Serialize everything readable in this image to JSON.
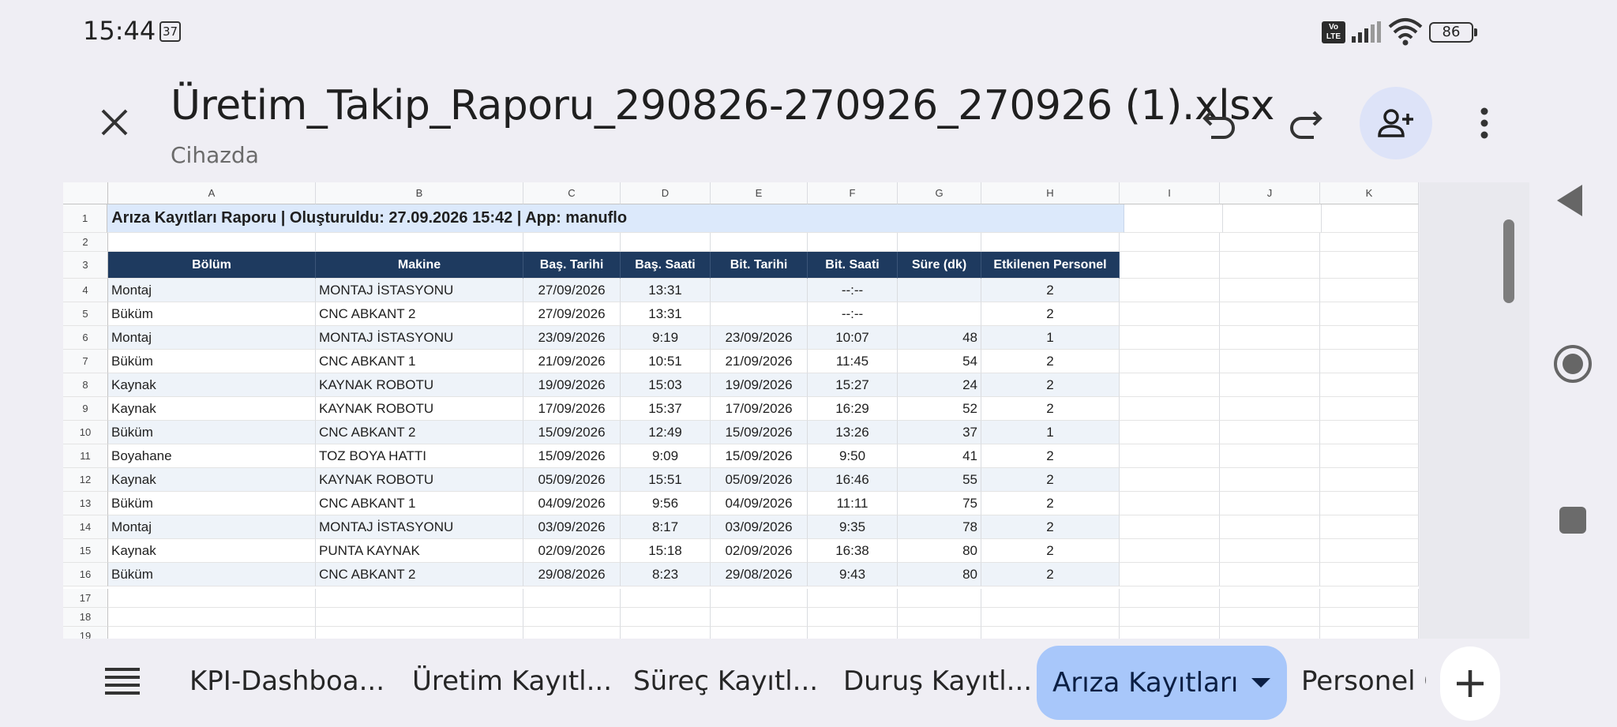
{
  "status": {
    "time": "15:44",
    "notification_count": "37",
    "network_badge": "Vo\nLTE",
    "battery": "86"
  },
  "appbar": {
    "title": "Üretim_Takip_Raporu_290826-270926_270926 (1).xlsx",
    "subtitle": "Cihazda"
  },
  "sheet": {
    "columns": [
      "A",
      "B",
      "C",
      "D",
      "E",
      "F",
      "G",
      "H",
      "I",
      "J",
      "K"
    ],
    "title_row": "Arıza Kayıtları Raporu  |  Oluşturuldu: 27.09.2026 15:42  |  App: manuflo",
    "headers": [
      "Bölüm",
      "Makine",
      "Baş. Tarihi",
      "Baş. Saati",
      "Bit. Tarihi",
      "Bit. Saati",
      "Süre (dk)",
      "Etkilenen Personel"
    ],
    "rows": [
      [
        "Montaj",
        "MONTAJ İSTASYONU",
        "27/09/2026",
        "13:31",
        "",
        "--:--",
        "",
        "2"
      ],
      [
        "Büküm",
        "CNC ABKANT 2",
        "27/09/2026",
        "13:31",
        "",
        "--:--",
        "",
        "2"
      ],
      [
        "Montaj",
        "MONTAJ İSTASYONU",
        "23/09/2026",
        "9:19",
        "23/09/2026",
        "10:07",
        "48",
        "1"
      ],
      [
        "Büküm",
        "CNC ABKANT 1",
        "21/09/2026",
        "10:51",
        "21/09/2026",
        "11:45",
        "54",
        "2"
      ],
      [
        "Kaynak",
        "KAYNAK ROBOTU",
        "19/09/2026",
        "15:03",
        "19/09/2026",
        "15:27",
        "24",
        "2"
      ],
      [
        "Kaynak",
        "KAYNAK ROBOTU",
        "17/09/2026",
        "15:37",
        "17/09/2026",
        "16:29",
        "52",
        "2"
      ],
      [
        "Büküm",
        "CNC ABKANT 2",
        "15/09/2026",
        "12:49",
        "15/09/2026",
        "13:26",
        "37",
        "1"
      ],
      [
        "Boyahane",
        "TOZ BOYA HATTI",
        "15/09/2026",
        "9:09",
        "15/09/2026",
        "9:50",
        "41",
        "2"
      ],
      [
        "Kaynak",
        "KAYNAK ROBOTU",
        "05/09/2026",
        "15:51",
        "05/09/2026",
        "16:46",
        "55",
        "2"
      ],
      [
        "Büküm",
        "CNC ABKANT 1",
        "04/09/2026",
        "9:56",
        "04/09/2026",
        "11:11",
        "75",
        "2"
      ],
      [
        "Montaj",
        "MONTAJ İSTASYONU",
        "03/09/2026",
        "8:17",
        "03/09/2026",
        "9:35",
        "78",
        "2"
      ],
      [
        "Kaynak",
        "PUNTA KAYNAK",
        "02/09/2026",
        "15:18",
        "02/09/2026",
        "16:38",
        "80",
        "2"
      ],
      [
        "Büküm",
        "CNC ABKANT 2",
        "29/08/2026",
        "8:23",
        "29/08/2026",
        "9:43",
        "80",
        "2"
      ]
    ],
    "row_numbers": [
      "1",
      "2",
      "3",
      "4",
      "5",
      "6",
      "7",
      "8",
      "9",
      "10",
      "11",
      "12",
      "13",
      "14",
      "15",
      "16",
      "17",
      "18",
      "19"
    ]
  },
  "tabs": {
    "items": [
      "KPI-Dashboa...",
      "Üretim Kayıtl...",
      "Süreç Kayıtl...",
      "Duruş Kayıtl...",
      "Arıza Kayıtları",
      "Personel G"
    ],
    "active_index": 4
  },
  "colors": {
    "header_dark": "#1e3a5f",
    "title_band": "#dce9fb",
    "active_tab": "#a8c7fa",
    "share_bg": "#dde3f8"
  }
}
